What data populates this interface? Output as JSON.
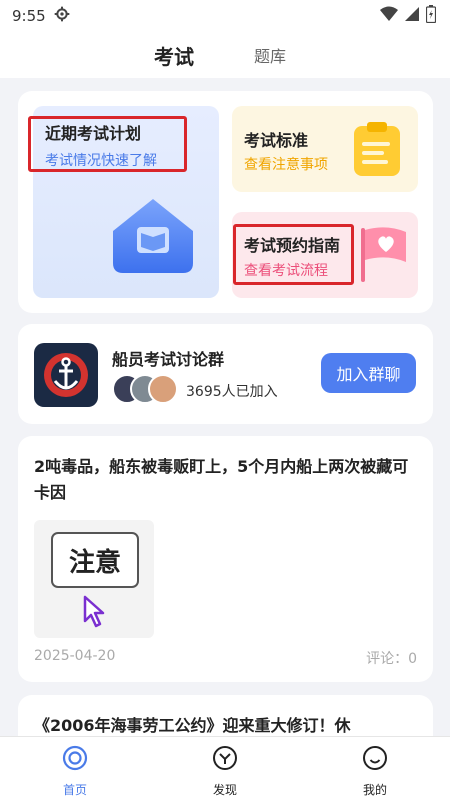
{
  "status_bar": {
    "time": "9:55"
  },
  "header": {
    "tabs": [
      {
        "label": "考试",
        "active": true
      },
      {
        "label": "题库",
        "active": false
      }
    ]
  },
  "feature_tiles": {
    "exam_plan": {
      "title": "近期考试计划",
      "subtitle": "考试情况快速了解",
      "color": "#4a7be8"
    },
    "exam_standard": {
      "title": "考试标准",
      "subtitle": "查看注意事项",
      "color": "#f0a500"
    },
    "booking_guide": {
      "title": "考试预约指南",
      "subtitle": "查看考试流程",
      "color": "#ec4f7a"
    }
  },
  "group": {
    "name": "船员考试讨论群",
    "member_count": "3695人已加入",
    "join_label": "加入群聊"
  },
  "news": [
    {
      "title": "2吨毒品，船东被毒贩盯上，5个月内船上两次被藏可卡因",
      "thumbnail_text": "注意",
      "date": "2025-04-20",
      "comments": "评论：0"
    },
    {
      "title": "《2006年海事劳工公约》迎来重大修订！休"
    }
  ],
  "bottom_nav": {
    "items": [
      {
        "label": "首页",
        "icon": "home-icon",
        "active": true
      },
      {
        "label": "发现",
        "icon": "discover-icon",
        "active": false
      },
      {
        "label": "我的",
        "icon": "profile-icon",
        "active": false
      }
    ]
  },
  "colors": {
    "accent": "#4f7ef0",
    "highlight_box": "#d9262b",
    "nav_active": "#4a7be8",
    "nav_inactive": "#222222"
  }
}
